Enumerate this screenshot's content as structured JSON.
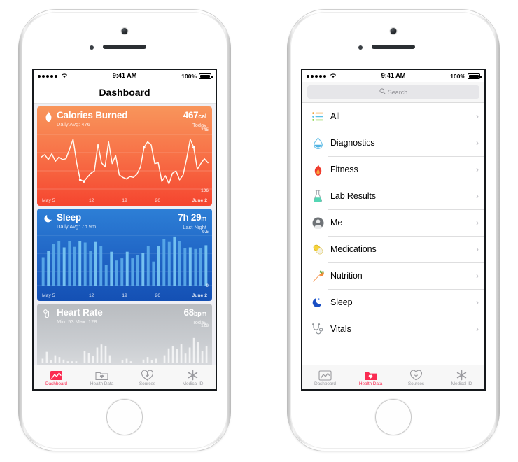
{
  "status_bar": {
    "carrier_dots": 5,
    "wifi_icon": "wifi-icon",
    "time": "9:41 AM",
    "battery_percent": "100%"
  },
  "left_phone": {
    "nav_title": "Dashboard",
    "cards": [
      {
        "id": "calories-burned",
        "icon": "flame-icon",
        "title": "Calories Burned",
        "subtitle": "Daily Avg: 476",
        "value": "467",
        "unit": "cal",
        "when": "Today",
        "y_max": "745",
        "y_min": "106",
        "x_labels": [
          "May 5",
          "12",
          "19",
          "26",
          "June 2"
        ]
      },
      {
        "id": "sleep",
        "icon": "moon-icon",
        "title": "Sleep",
        "subtitle": "Daily Avg: 7h 9m",
        "value": "7h 29",
        "unit": "m",
        "when": "Last Night",
        "y_max": "9.5",
        "y_min": "0",
        "x_labels": [
          "May 5",
          "12",
          "19",
          "26",
          "June 2"
        ]
      },
      {
        "id": "heart-rate",
        "icon": "heart-rate-icon",
        "title": "Heart Rate",
        "subtitle": "Min: 53 Max: 128",
        "value": "68",
        "unit": "bpm",
        "when": "Today",
        "y_max": "128",
        "y_min": "",
        "x_labels": []
      }
    ]
  },
  "right_phone": {
    "search": {
      "placeholder": "Search",
      "icon": "search-icon"
    },
    "list": [
      {
        "icon": "list-icon",
        "label": "All",
        "chevron": "›"
      },
      {
        "icon": "droplet-icon",
        "label": "Diagnostics",
        "chevron": "›"
      },
      {
        "icon": "flame-icon",
        "label": "Fitness",
        "chevron": "›"
      },
      {
        "icon": "flask-icon",
        "label": "Lab Results",
        "chevron": "›"
      },
      {
        "icon": "person-icon",
        "label": "Me",
        "chevron": "›"
      },
      {
        "icon": "pill-icon",
        "label": "Medications",
        "chevron": "›"
      },
      {
        "icon": "carrot-icon",
        "label": "Nutrition",
        "chevron": "›"
      },
      {
        "icon": "moon-icon",
        "label": "Sleep",
        "chevron": "›"
      },
      {
        "icon": "stethoscope-icon",
        "label": "Vitals",
        "chevron": "›"
      }
    ]
  },
  "tab_bar": {
    "active_color": "#fa2c52",
    "inactive_color": "#9a9a9f",
    "tabs": [
      {
        "icon": "dashboard-icon",
        "label": "Dashboard"
      },
      {
        "icon": "health-data-icon",
        "label": "Health Data"
      },
      {
        "icon": "sources-icon",
        "label": "Sources"
      },
      {
        "icon": "medical-id-icon",
        "label": "Medical ID"
      }
    ]
  },
  "chart_data": [
    {
      "type": "line",
      "title": "Calories Burned",
      "ylabel": "cal",
      "xlabel": "",
      "ylim": [
        106,
        745
      ],
      "grid": true,
      "tick_labels_x": [
        "May 5",
        "12",
        "19",
        "26",
        "June 2"
      ],
      "tick_labels_y": [
        "745",
        "106"
      ],
      "values": [
        500,
        530,
        470,
        540,
        450,
        500,
        470,
        480,
        600,
        720,
        430,
        220,
        200,
        250,
        300,
        330,
        660,
        430,
        380,
        690,
        420,
        520,
        280,
        250,
        230,
        260,
        250,
        290,
        380,
        620,
        690,
        650,
        420,
        430,
        200,
        270,
        170,
        300,
        330,
        220,
        280,
        480,
        720,
        620,
        350,
        420,
        480,
        430
      ]
    },
    {
      "type": "bar",
      "title": "Sleep",
      "ylabel": "hours",
      "xlabel": "",
      "ylim": [
        0,
        9.5
      ],
      "grid": true,
      "tick_labels_x": [
        "May 5",
        "12",
        "19",
        "26",
        "June 2"
      ],
      "tick_labels_y": [
        "9.5",
        "0"
      ],
      "values": [
        5.2,
        6.3,
        7.6,
        8.1,
        7.0,
        8.2,
        7.1,
        8.2,
        7.9,
        6.4,
        8.0,
        7.3,
        3.8,
        6.2,
        4.6,
        5.0,
        6.2,
        5.0,
        5.6,
        6.0,
        7.2,
        4.4,
        7.2,
        8.6,
        8.0,
        9.0,
        8.2,
        6.8,
        7.0,
        6.7,
        6.8,
        7.4
      ]
    },
    {
      "type": "bar",
      "title": "Heart Rate",
      "ylabel": "bpm",
      "xlabel": "",
      "ylim": [
        53,
        128
      ],
      "grid": false,
      "tick_labels_x": [],
      "tick_labels_y": [
        "128"
      ],
      "values": [
        62,
        78,
        58,
        70,
        66,
        60,
        56,
        54,
        53,
        0,
        80,
        75,
        68,
        88,
        95,
        92,
        70,
        0,
        0,
        58,
        62,
        56,
        0,
        0,
        60,
        66,
        58,
        62,
        0,
        70,
        86,
        92,
        84,
        96,
        74,
        88,
        110,
        100,
        80,
        92
      ]
    }
  ]
}
